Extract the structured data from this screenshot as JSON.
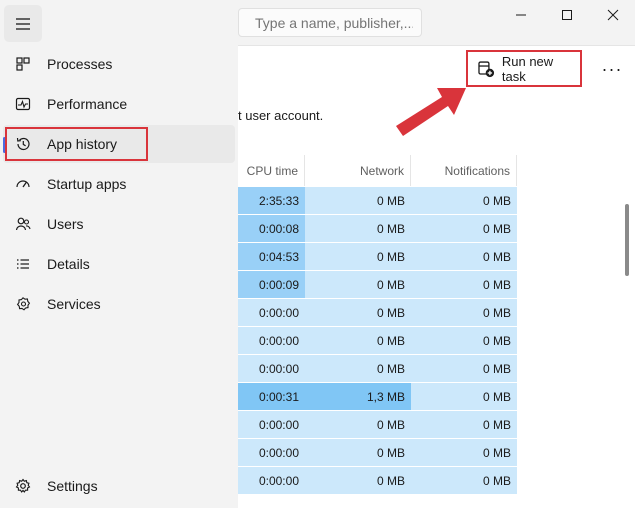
{
  "search": {
    "placeholder": "Type a name, publisher,..."
  },
  "window": {
    "minimize": "–",
    "maximize": "☐",
    "close": "✕"
  },
  "toolbar": {
    "run_new_task": "Run new task",
    "more": "···"
  },
  "description": "t user account.",
  "sidebar": {
    "items": [
      {
        "label": "Processes",
        "icon": "processes-icon"
      },
      {
        "label": "Performance",
        "icon": "performance-icon"
      },
      {
        "label": "App history",
        "icon": "history-icon",
        "active": true
      },
      {
        "label": "Startup apps",
        "icon": "startup-icon"
      },
      {
        "label": "Users",
        "icon": "users-icon"
      },
      {
        "label": "Details",
        "icon": "details-icon"
      },
      {
        "label": "Services",
        "icon": "services-icon"
      }
    ],
    "settings": {
      "label": "Settings",
      "icon": "gear-icon"
    }
  },
  "table": {
    "columns": [
      "CPU time",
      "Network",
      "Notifications"
    ],
    "rows": [
      {
        "cpu": "2:35:33",
        "net": "0 MB",
        "notif": "0 MB",
        "heat": 2
      },
      {
        "cpu": "0:00:08",
        "net": "0 MB",
        "notif": "0 MB",
        "heat": 2
      },
      {
        "cpu": "0:04:53",
        "net": "0 MB",
        "notif": "0 MB",
        "heat": 2
      },
      {
        "cpu": "0:00:09",
        "net": "0 MB",
        "notif": "0 MB",
        "heat": 2
      },
      {
        "cpu": "0:00:00",
        "net": "0 MB",
        "notif": "0 MB",
        "heat": 1
      },
      {
        "cpu": "0:00:00",
        "net": "0 MB",
        "notif": "0 MB",
        "heat": 1
      },
      {
        "cpu": "0:00:00",
        "net": "0 MB",
        "notif": "0 MB",
        "heat": 1
      },
      {
        "cpu": "0:00:31",
        "net": "1,3 MB",
        "notif": "0 MB",
        "heat": 3
      },
      {
        "cpu": "0:00:00",
        "net": "0 MB",
        "notif": "0 MB",
        "heat": 1
      },
      {
        "cpu": "0:00:00",
        "net": "0 MB",
        "notif": "0 MB",
        "heat": 1
      },
      {
        "cpu": "0:00:00",
        "net": "0 MB",
        "notif": "0 MB",
        "heat": 1
      }
    ]
  },
  "colors": {
    "accent": "#4c6be0",
    "highlight": "#d9343b",
    "cell_light": "#cce8fb",
    "cell_mid": "#99d0f7"
  }
}
